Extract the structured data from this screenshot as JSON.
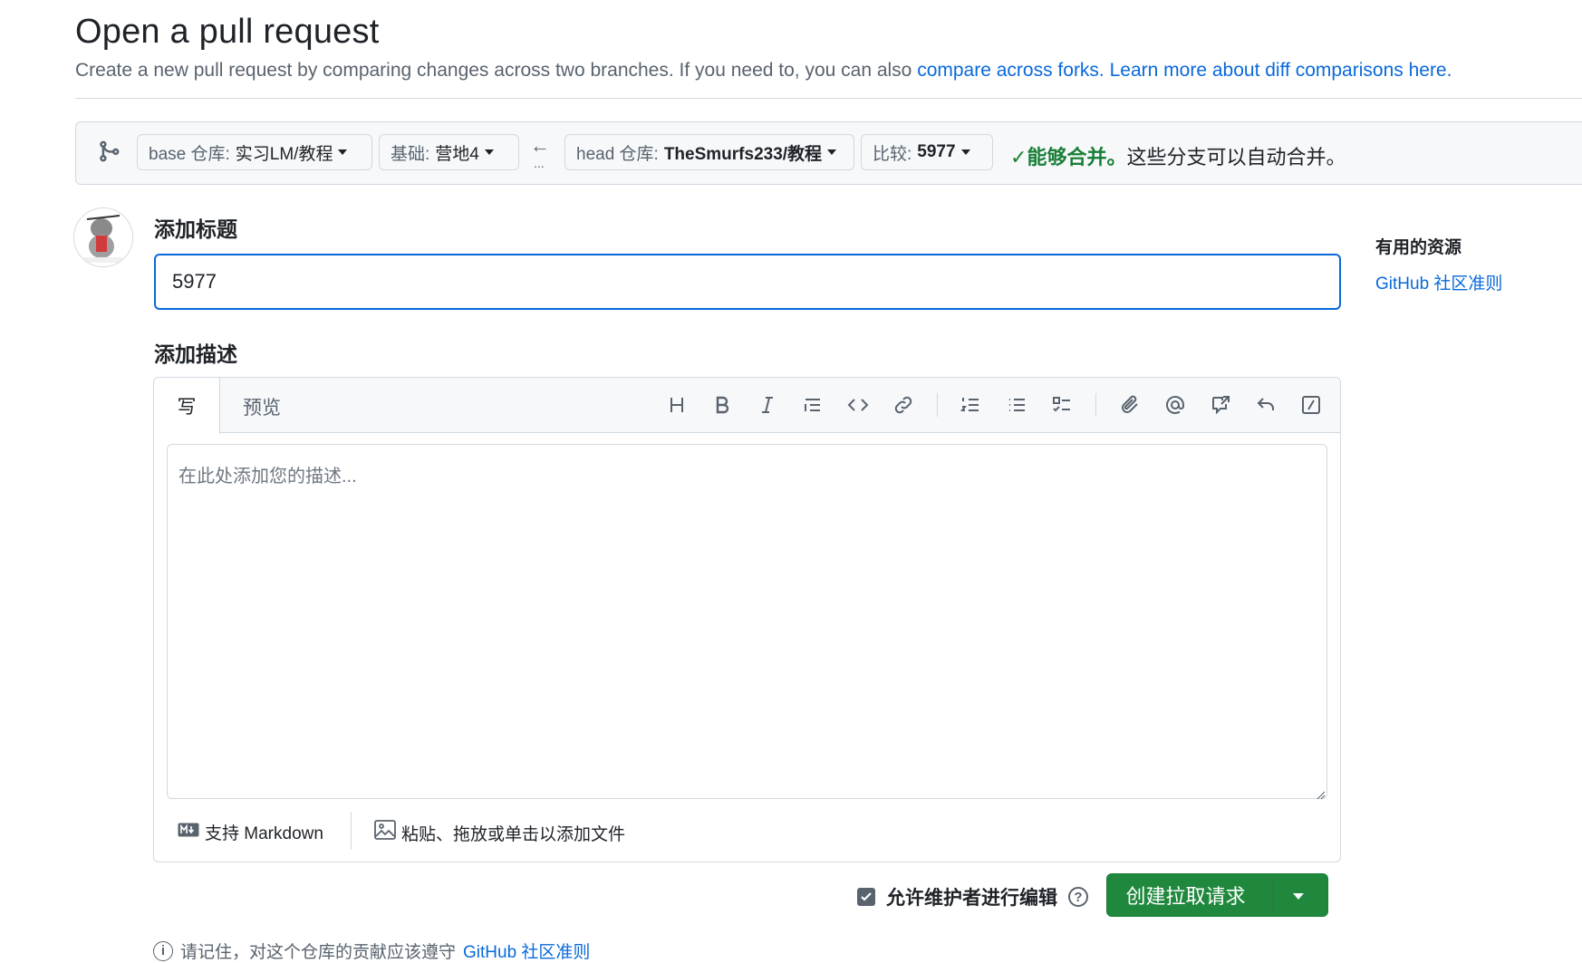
{
  "header": {
    "title": "Open a pull request",
    "subtitle_text": "Create a new pull request by comparing changes across two branches. If you need to, you can also ",
    "link_forks": "compare across forks.",
    "link_learn": "Learn more about diff comparisons here."
  },
  "compare": {
    "base_repo_label": "base 仓库:",
    "base_repo_value": "实习LM/教程",
    "base_branch_label": "基础:",
    "base_branch_value": "营地4",
    "arrow": "←",
    "ellipsis": "...",
    "head_repo_label": "head 仓库:",
    "head_repo_value": "TheSmurfs233/教程",
    "compare_label": "比较:",
    "compare_value": "5977",
    "merge_ok": "能够合并。",
    "merge_text": "这些分支可以自动合并。"
  },
  "form": {
    "title_label": "添加标题",
    "title_value": "5977",
    "desc_label": "添加描述",
    "tab_write": "写",
    "tab_preview": "预览",
    "desc_placeholder": "在此处添加您的描述...",
    "markdown_note": "支持 Markdown",
    "file_note": "粘贴、拖放或单击以添加文件"
  },
  "toolbar_icons": [
    "heading-icon",
    "bold-icon",
    "italic-icon",
    "quote-icon",
    "code-icon",
    "link-icon",
    "ordered-list-icon",
    "unordered-list-icon",
    "task-list-icon",
    "attach-icon",
    "mention-icon",
    "cross-reference-icon",
    "reply-icon",
    "slash-command-icon"
  ],
  "actions": {
    "allow_edit": "允许维护者进行编辑",
    "help": "?",
    "create_button": "创建拉取请求"
  },
  "note": {
    "text": "请记住，对这个仓库的贡献应该遵守",
    "link": "GitHub 社区准则"
  },
  "sidebar": {
    "title": "有用的资源",
    "link": "GitHub 社区准则"
  },
  "colors": {
    "accent": "#0969da",
    "success": "#1a7f37",
    "button": "#1f883d"
  }
}
